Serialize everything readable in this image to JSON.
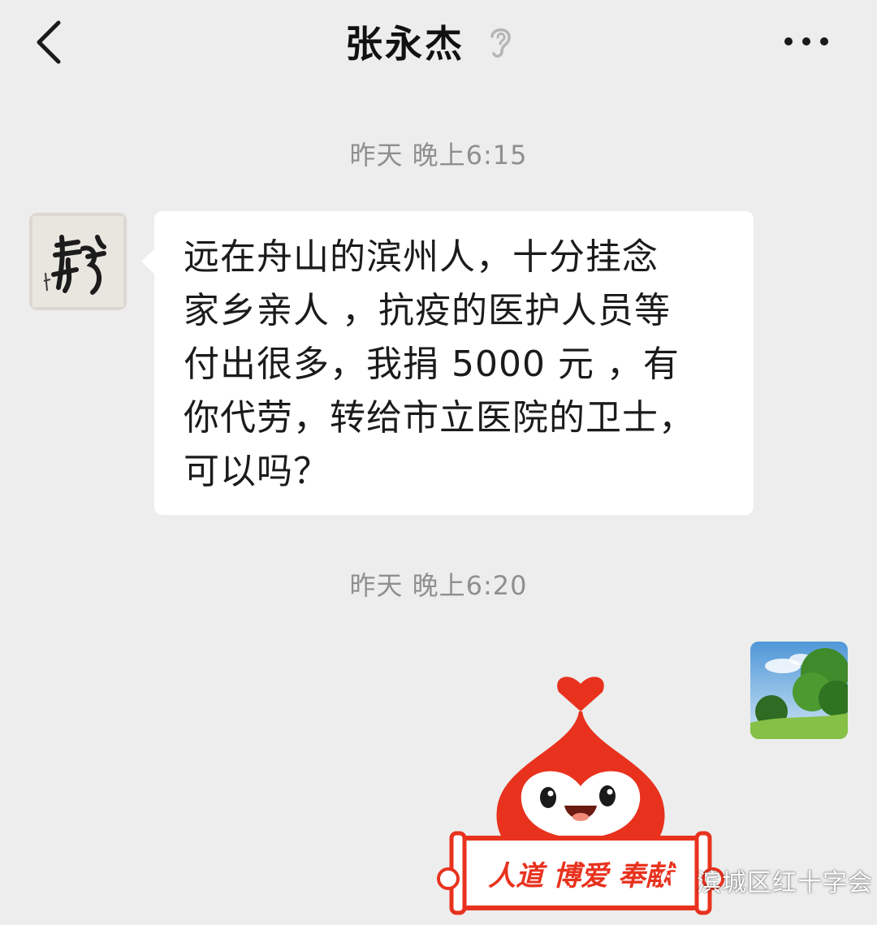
{
  "header": {
    "title": "张永杰",
    "back_icon": "chevron-left-icon",
    "ear_icon": "ear-icon",
    "more_icon": "more-dots-icon"
  },
  "messages": [
    {
      "timestamp": "昨天 晚上6:15",
      "sender": "contact",
      "text": "远在舟山的滨州人，十分挂念\n家乡亲人 ，抗疫的医护人员等\n付出很多，我捐 5000 元 ，有\n你代劳，转给市立医院的卫士，\n可以吗？"
    },
    {
      "timestamp": "昨天 晚上6:20",
      "sender": "me",
      "sticker_banner": "人道 博爱 奉献"
    }
  ],
  "watermark": {
    "text": "滨城区红十字会",
    "icon": "wechat-icon"
  },
  "colors": {
    "background": "#ededed",
    "bubble": "#ffffff",
    "timestamp": "#8f8f8f",
    "mascot_red": "#e8321e"
  }
}
